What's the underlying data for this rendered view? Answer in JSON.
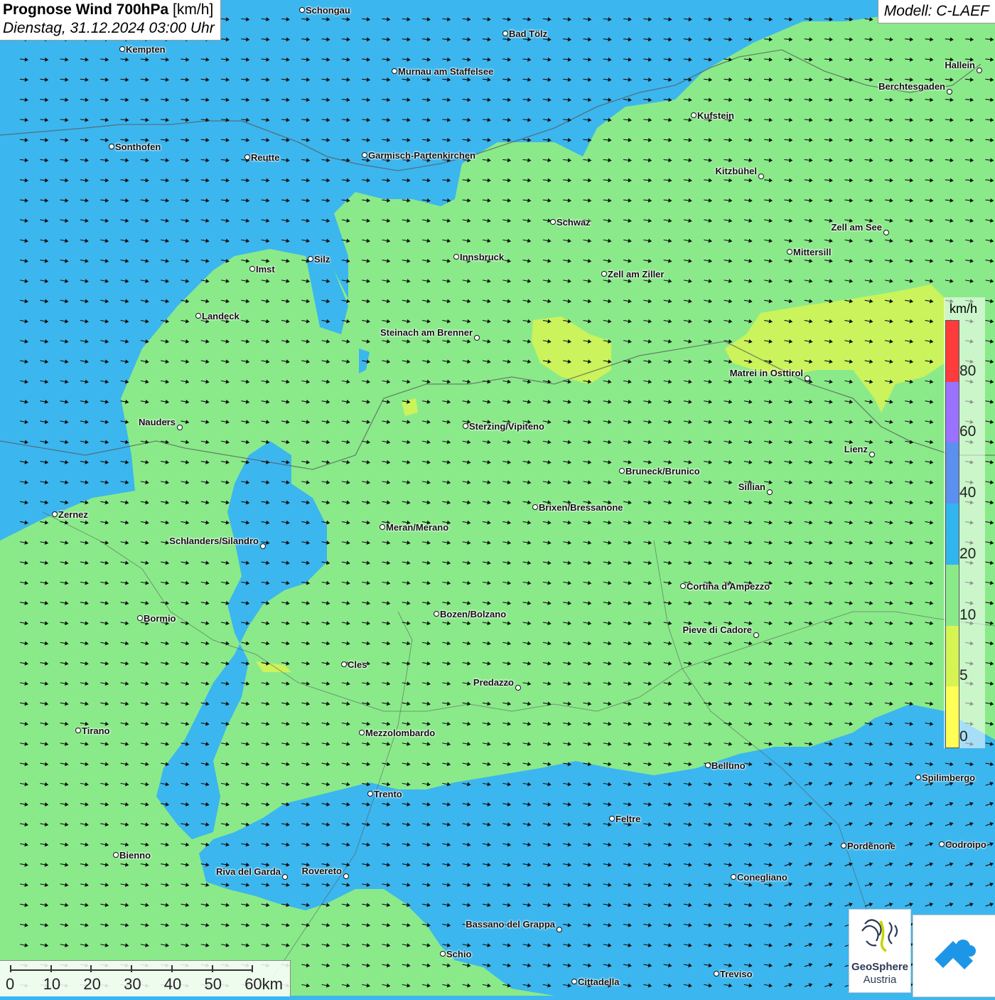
{
  "header": {
    "title_bold": "Prognose Wind 700hPa",
    "title_unit": "[km/h]",
    "date": "Dienstag, 31.12.2024 03:00 Uhr",
    "model": "Modell: C-LAEF"
  },
  "legend": {
    "unit": "km/h",
    "labels": [
      "80",
      "60",
      "40",
      "20",
      "10",
      "5",
      "0"
    ],
    "colors": [
      "#ff3b3b",
      "#9a72ff",
      "#5b8ff0",
      "#31b5ef",
      "#8aea8a",
      "#d6f452",
      "#ffff55"
    ]
  },
  "scalebar": {
    "labels": [
      "0",
      "10",
      "20",
      "30",
      "40",
      "50",
      "60km"
    ]
  },
  "logo": {
    "name": "GeoSphere",
    "sub": "Austria"
  },
  "wind": {
    "direction": "east",
    "note_colors": {
      "calm": "#ffff55",
      "light": "#8aea8a",
      "moderate": "#31b5ef"
    }
  },
  "cities": [
    "Schongau",
    "Bad Tölz",
    "Kempten",
    "Murnau am Staffelsee",
    "Hallein",
    "Berchtesgaden",
    "Kufstein",
    "Sonthofen",
    "Reutte",
    "Garmisch-Partenkirchen",
    "Kitzbühel",
    "Schwaz",
    "Zell am See",
    "Innsbruck",
    "Mittersill",
    "Silz",
    "Imst",
    "Zell am Ziller",
    "Landeck",
    "Steinach am Brenner",
    "Matrei in Osttirol",
    "Nauders",
    "Sterzing/Vipiteno",
    "Lienz",
    "Bruneck/Brunico",
    "Sillian",
    "Brixen/Bressanone",
    "Zernez",
    "Meran/Merano",
    "Schlanders/Silandro",
    "Cortina d'Ampezzo",
    "Bozen/Bolzano",
    "Bormio",
    "Pieve di Cadore",
    "Cles",
    "Predazzo",
    "Tirano",
    "Mezzolombardo",
    "Belluno",
    "Spilimbergo",
    "Trento",
    "Feltre",
    "Pordenone",
    "Codroipo",
    "Bienno",
    "Riva del Garda",
    "Rovereto",
    "Conegliano",
    "Bassano del Grappa",
    "Schio",
    "Treviso",
    "Cittadella"
  ]
}
